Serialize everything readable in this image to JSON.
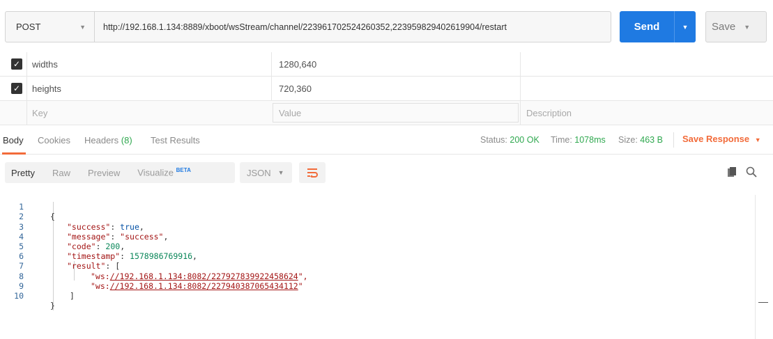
{
  "request": {
    "method": "POST",
    "url": "http://192.168.1.134:8889/xboot/wsStream/channel/223961702524260352,223959829402619904/restart",
    "send_label": "Send",
    "save_label": "Save"
  },
  "params": {
    "rows": [
      {
        "key": "widths",
        "value": "1280,640",
        "description": ""
      },
      {
        "key": "heights",
        "value": "720,360",
        "description": ""
      }
    ],
    "placeholder_key": "Key",
    "placeholder_value": "Value",
    "placeholder_description": "Description"
  },
  "response_tabs": {
    "body": "Body",
    "cookies": "Cookies",
    "headers_label": "Headers",
    "headers_count": "(8)",
    "test_results": "Test Results"
  },
  "status": {
    "status_label": "Status:",
    "status_value": "200 OK",
    "time_label": "Time:",
    "time_value": "1078ms",
    "size_label": "Size:",
    "size_value": "463 B",
    "save_response": "Save Response"
  },
  "format": {
    "pretty": "Pretty",
    "raw": "Raw",
    "preview": "Preview",
    "visualize": "Visualize",
    "beta": "BETA",
    "language": "JSON"
  },
  "code": {
    "line_numbers": [
      "1",
      "2",
      "3",
      "4",
      "5",
      "6",
      "7",
      "8",
      "9",
      "10"
    ],
    "l1": "{",
    "l2_key": "\"success\"",
    "l2_val": "true",
    "l3_key": "\"message\"",
    "l3_val": "\"success\"",
    "l4_key": "\"code\"",
    "l4_val": "200",
    "l5_key": "\"timestamp\"",
    "l5_val": "1578986769916",
    "l6_key": "\"result\"",
    "l6_val": "[",
    "l7_prefix": "\"ws:",
    "l7_link": "//192.168.1.134:8082/227927839922458624",
    "l7_suffix": "\",",
    "l8_prefix": "\"ws:",
    "l8_link": "//192.168.1.134:8082/227940387065434112",
    "l8_suffix": "\"",
    "l9": "]",
    "l10": "}"
  },
  "colors": {
    "accent": "#1f7ae2",
    "orange": "#f26b3a",
    "green": "#2fa84f"
  }
}
